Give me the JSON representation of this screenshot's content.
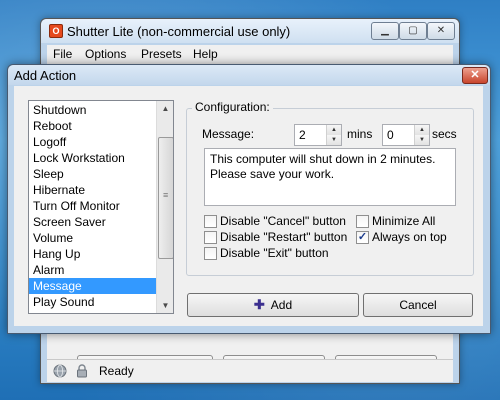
{
  "main_window": {
    "app_icon_label": "O",
    "title": "Shutter Lite (non-commercial use only)",
    "menu": [
      "File",
      "Options",
      "Presets",
      "Help"
    ],
    "status_text": "Ready"
  },
  "dialog": {
    "title": "Add Action",
    "actions": [
      "Shutdown",
      "Reboot",
      "Logoff",
      "Lock Workstation",
      "Sleep",
      "Hibernate",
      "Turn Off Monitor",
      "Screen Saver",
      "Volume",
      "Hang Up",
      "Alarm",
      "Message",
      "Play Sound"
    ],
    "selected_action": "Message",
    "configuration": {
      "group_label": "Configuration:",
      "message_label": "Message:",
      "mins_value": "2",
      "mins_label": "mins",
      "secs_value": "0",
      "secs_label": "secs",
      "message_text": "This computer will shut down in 2 minutes. Please save your work.",
      "checkboxes": [
        {
          "label": "Disable \"Cancel\" button",
          "checked": false
        },
        {
          "label": "Disable \"Restart\" button",
          "checked": false
        },
        {
          "label": "Disable \"Exit\" button",
          "checked": false
        },
        {
          "label": "Minimize All",
          "checked": false
        },
        {
          "label": "Always on top",
          "checked": true
        }
      ]
    },
    "add_button": "Add",
    "cancel_button": "Cancel"
  },
  "icons": {
    "app": "shutter-app-icon",
    "close": "close-icon",
    "add": "plus-icon",
    "status_globe": "globe-icon",
    "status_lock": "lock-icon"
  },
  "colors": {
    "selection": "#3399ff",
    "close_button": "#c8452c",
    "title_bar": "#c3d7ec"
  }
}
